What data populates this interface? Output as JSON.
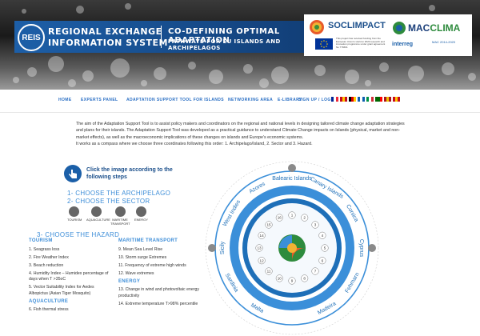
{
  "banner": {
    "logo_text": "REIS",
    "title_line1": "REGIONAL EXCHANGE",
    "title_line2": "INFORMATION SYSTEM",
    "co_title_line1": "CO-DEFINING OPTIMAL ADAPTATION",
    "co_title_line2": "PATHWAYS FOR EU ISLANDS AND ARCHIPELAGOS",
    "partner1": "SOCLIMPACT",
    "funding_note": "This project has received funding from the European Union's Horizon 2020 research and innovation programme under grant agreement No 776661",
    "partner2_a": "MAC",
    "partner2_b": "CLIMA",
    "interreg": "interreg",
    "mac_program": "MAC 2014-2020"
  },
  "nav": {
    "items": [
      "HOME",
      "EXPERTS PANEL",
      "ADAPTATION SUPPORT TOOL FOR ISLANDS",
      "NETWORKING AREA",
      "E-LIBRARY",
      "SIGN UP / LOGIN"
    ],
    "active_index": 2,
    "flag_colors": [
      [
        "#002395",
        "#ffffff",
        "#ed2939"
      ],
      [
        "#c60b1e",
        "#ffc400",
        "#c60b1e"
      ],
      [
        "#000000",
        "#dd0000",
        "#ffce00"
      ],
      [
        "#0d5eaf",
        "#ffffff",
        "#0d5eaf"
      ],
      [
        "#009246",
        "#ffffff",
        "#ce2b37"
      ],
      [
        "#006600",
        "#006600",
        "#ff0000"
      ],
      [
        "#aa151b",
        "#f1bf00",
        "#aa151b"
      ],
      [
        "#c60b1e",
        "#ffc400",
        "#c60b1e"
      ]
    ]
  },
  "intro": {
    "p1": "The aim of the Adaptation Support Tool is to assist policy makers and coordinators on the regional and national levels in designing tailored climate change adaptation strategies and plans for their islands. The Adaptation Support Tool was developed as a practical guidance to understand  Climate Change impacts on Islands (physical, market and non-market effects), as well as the macroeconomic implications of these changes on islands and Europe's economic systems.",
    "p2": "It works as a compass where we choose three coordinates following this order:  1. Archipelago/Island, 2. Sector and 3. Hazard."
  },
  "guide": {
    "click_text": "Click the image according to the following steps",
    "step1": "1- CHOOSE THE ARCHIPELAGO",
    "step2": "2- CHOOSE THE SECTOR",
    "step3": "3- CHOOSE THE HAZARD"
  },
  "sectors": [
    "TOURISM",
    "AQUACULTURE",
    "MARITIME TRANSPORT",
    "ENERGY"
  ],
  "hazards": {
    "tourism_title": "TOURISM",
    "tourism": [
      "1. Seagrass loss",
      "2. Fire Weather Index",
      "3. Beach reduction",
      "4. Humidity Index – Humidex percentage of days when T >35oC",
      "5. Vector Suitability Index for Aedes Albopictus (Asian Tiger Mosquito)"
    ],
    "aquaculture_title": "AQUACULTURE",
    "aquaculture": [
      "6. Fish thermal stress"
    ],
    "maritime_title": "MARITIME TRANSPORT",
    "maritime": [
      "9. Mean Sea Level Rise",
      "10. Storm surge Extremes",
      "11. Frequency of extreme high winds",
      "12. Wave extremes"
    ],
    "energy_title": "ENERGY",
    "energy": [
      "13. Change in wind and photovoltaic energy productivity",
      "14. Extreme temperature T>98% percentile"
    ]
  },
  "wheel": {
    "islands": [
      "Malta",
      "Sardinia",
      "Sicily",
      "West Indies",
      "Azores",
      "Balearic Islands",
      "Canary Islands",
      "Corsica",
      "Cyprus",
      "Fehmarn",
      "Madeira"
    ],
    "numbers": [
      "1",
      "2",
      "3",
      "4",
      "5",
      "6",
      "7",
      "8",
      "9",
      "10",
      "11",
      "12",
      "13",
      "14",
      "15",
      "16"
    ],
    "ring_color": "#3b8fd9",
    "dark_ring": "#1e6fb8"
  }
}
